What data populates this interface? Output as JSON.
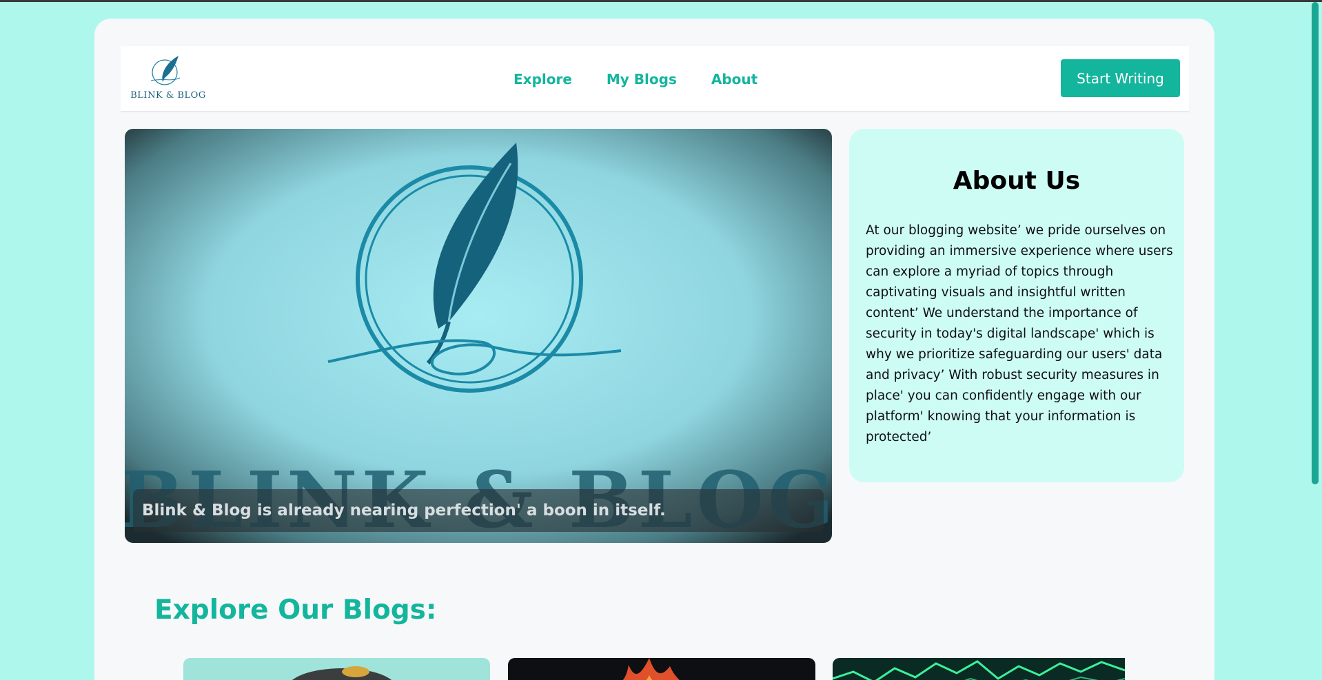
{
  "navbar": {
    "logo_text": "BLINK & BLOG",
    "links": [
      "Explore",
      "My Blogs",
      "About"
    ],
    "cta": "Start Writing"
  },
  "hero": {
    "image_text": "BLINK & BLOG",
    "caption": "Blink & Blog is already nearing perfection' a boon in itself."
  },
  "about": {
    "title": "About Us",
    "body": "At our blogging website’ we pride ourselves on providing an immersive experience where users can explore a myriad of topics through captivating visuals and insightful written content’ We understand the importance of security in today's digital landscape' which is why we prioritize safeguarding our users' data and privacy’ With robust security measures in place' you can confidently engage with our platform' knowing that your information is protected’"
  },
  "explore": {
    "title": "Explore Our Blogs:"
  },
  "colors": {
    "accent": "#14b59d",
    "page_bg": "#aef7ec",
    "about_bg": "#cdfcf5",
    "logo_blue": "#1d5f7e"
  }
}
